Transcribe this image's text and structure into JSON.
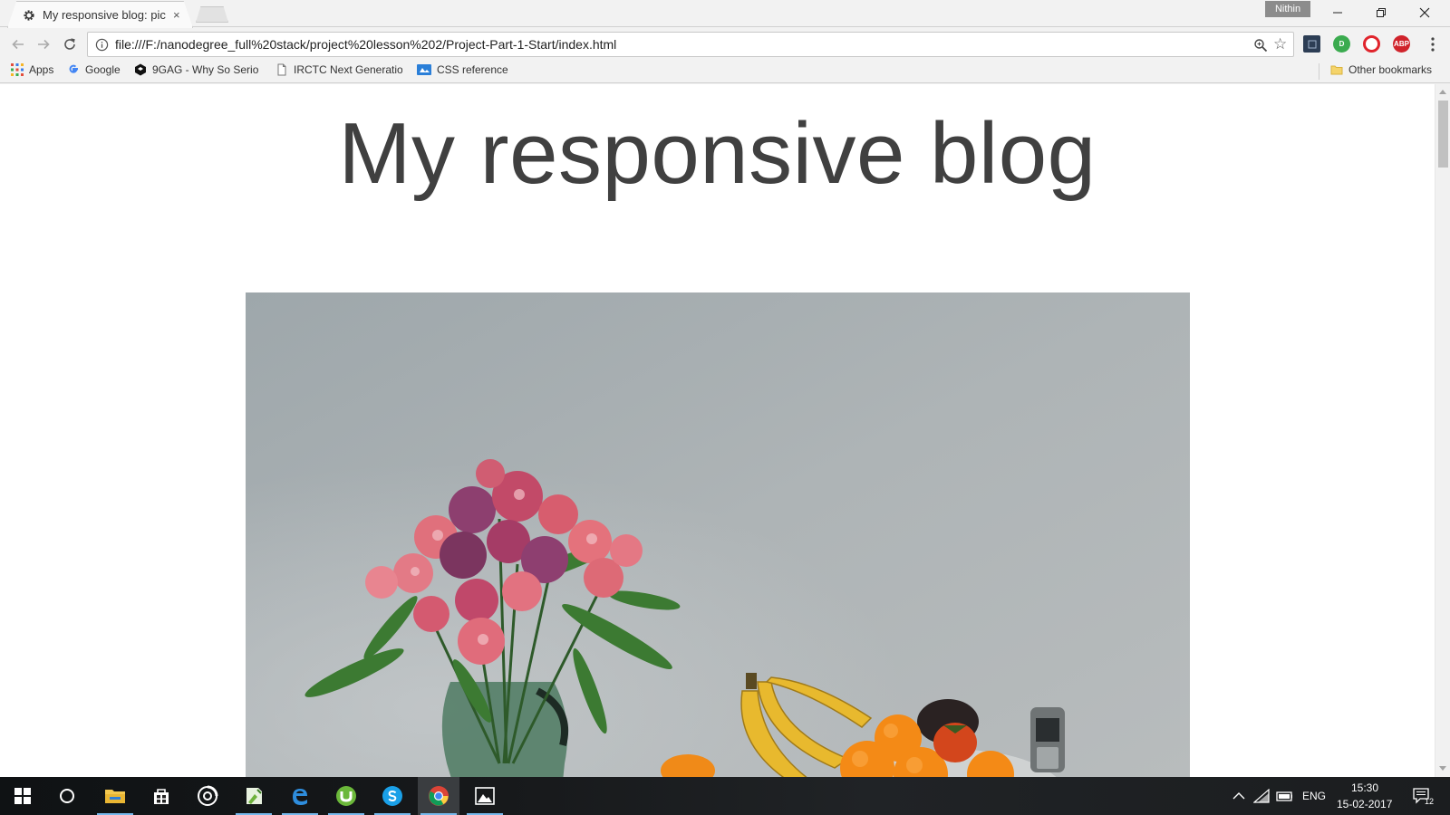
{
  "browser": {
    "tab": {
      "title": "My responsive blog: pict",
      "close": "×"
    },
    "profile_name": "Nithin",
    "address_bar": {
      "url": "file:///F:/nanodegree_full%20stack/project%20lesson%202/Project-Part-1-Start/index.html"
    },
    "extensions": [
      {
        "name": "extension-icon",
        "label": ""
      },
      {
        "name": "green-extension-icon",
        "label": "D"
      },
      {
        "name": "opera-extension-icon",
        "label": ""
      },
      {
        "name": "adblock-plus-icon",
        "label": "ABP"
      }
    ],
    "bookmarks": [
      {
        "label": "Apps",
        "icon": "apps-grid-icon"
      },
      {
        "label": "Google",
        "icon": "google-icon"
      },
      {
        "label": "9GAG - Why So Serio",
        "icon": "9gag-icon"
      },
      {
        "label": "IRCTC Next Generatio",
        "icon": "page-icon"
      },
      {
        "label": "CSS reference",
        "icon": "css-reference-icon"
      }
    ],
    "other_bookmarks": "Other bookmarks"
  },
  "page": {
    "heading": "My responsive blog"
  },
  "taskbar": {
    "language": "ENG",
    "time": "15:30",
    "date": "15-02-2017",
    "notification_count": "12"
  },
  "colors": {
    "heading": "#404040",
    "chrome_bg": "#f2f2f2",
    "taskbar_accent": "#76b9ed",
    "wall": "#a9b0b3"
  }
}
